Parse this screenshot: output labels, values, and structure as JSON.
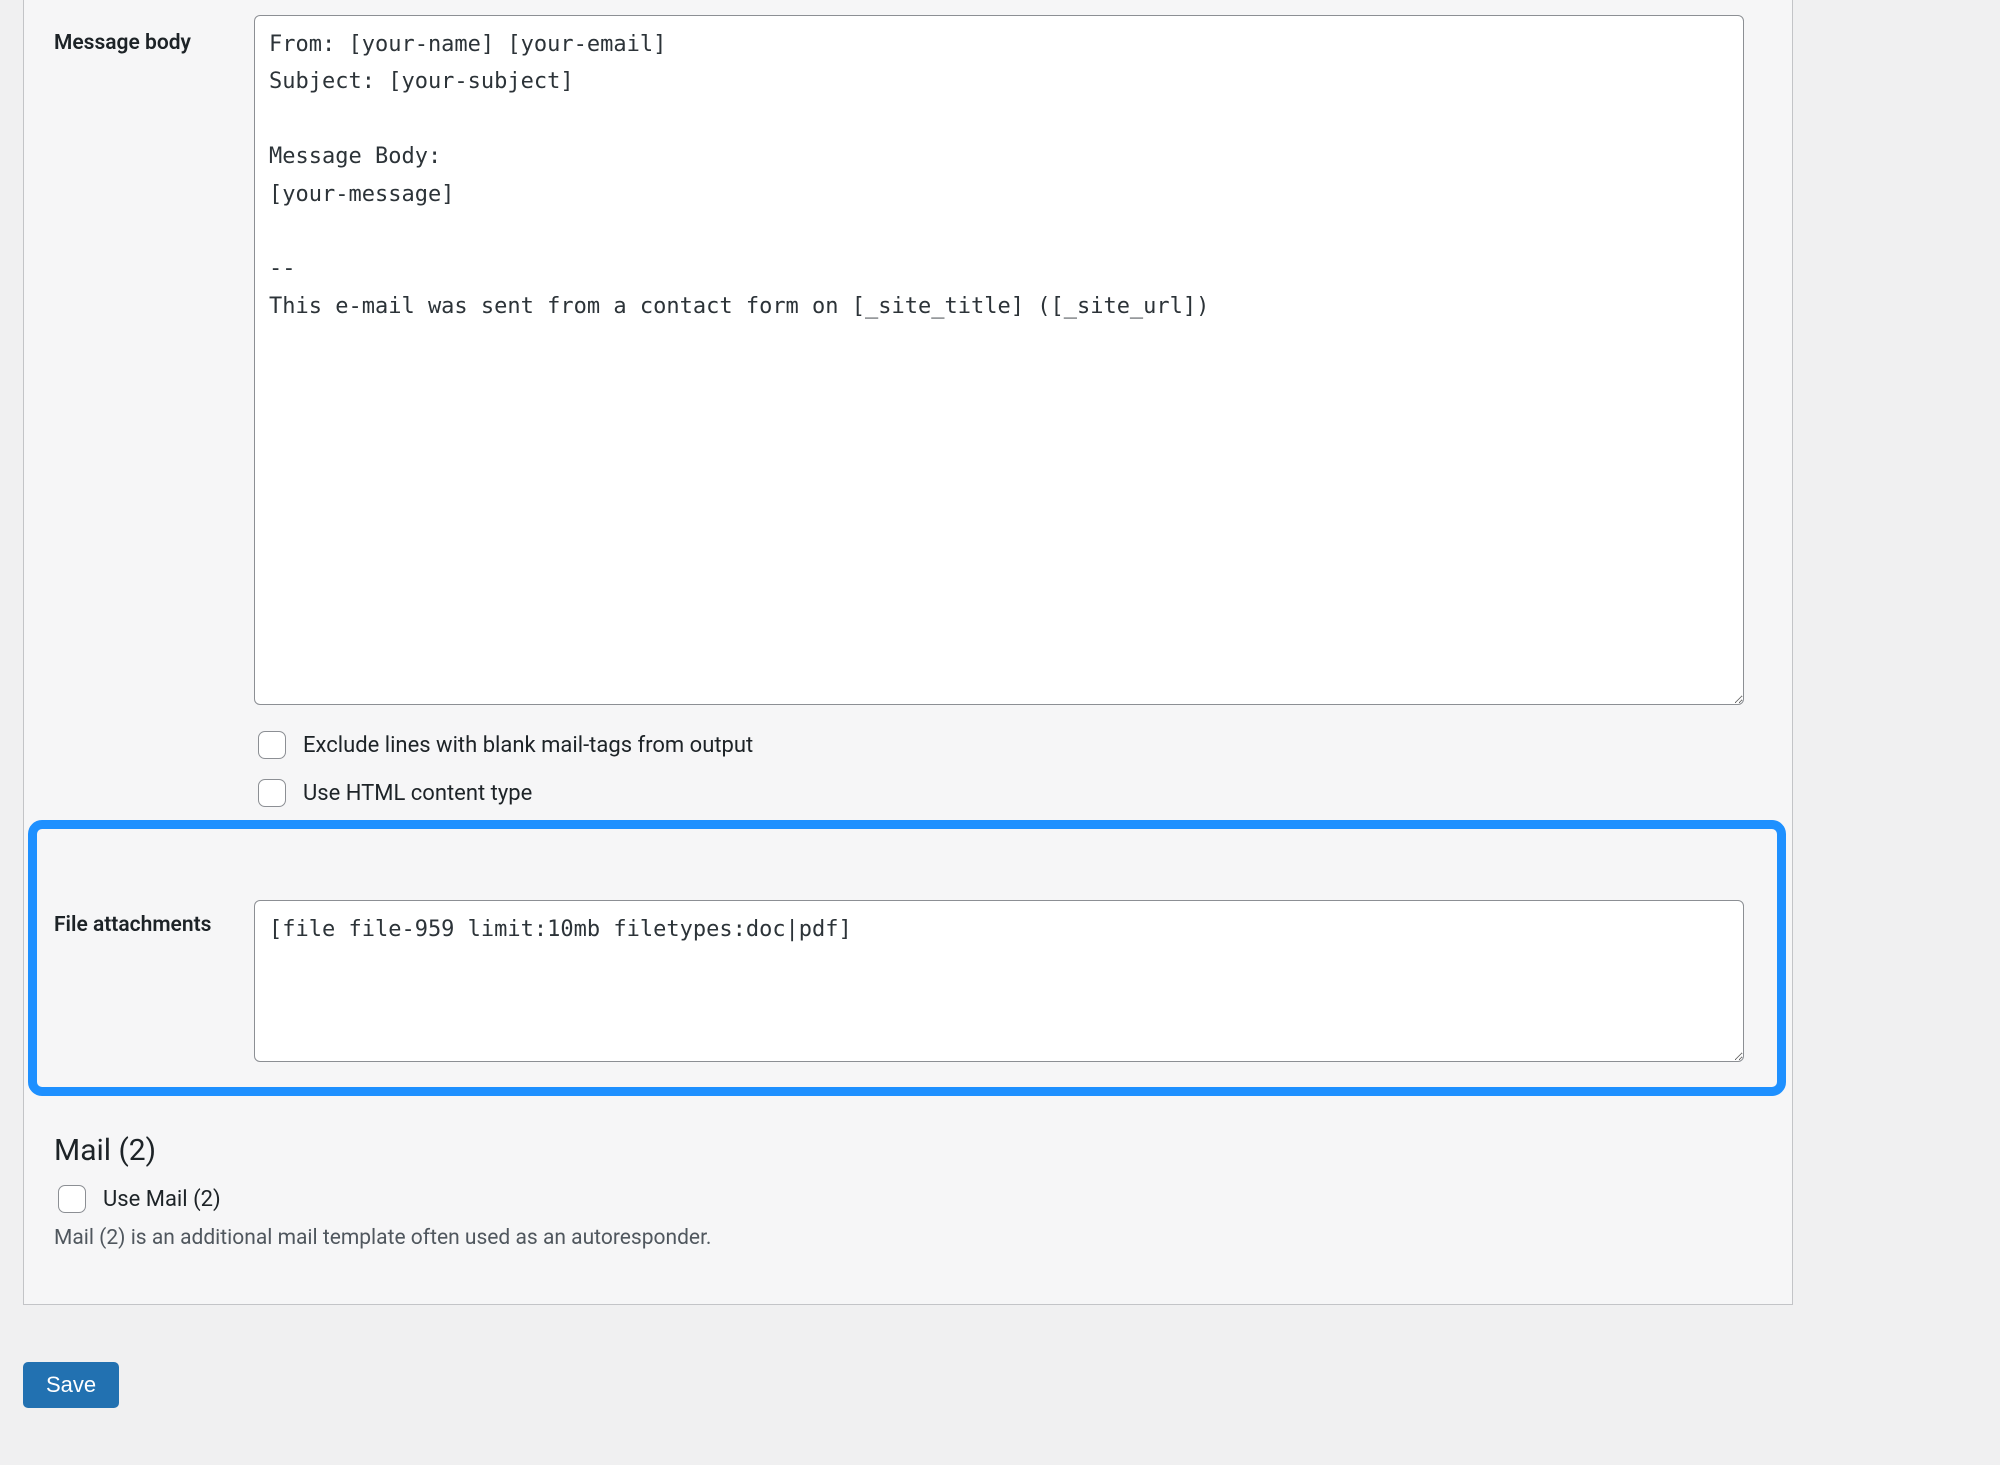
{
  "message_body": {
    "label": "Message body",
    "value": "From: [your-name] [your-email]\nSubject: [your-subject]\n\nMessage Body:\n[your-message]\n\n--\nThis e-mail was sent from a contact form on [_site_title] ([_site_url])",
    "checkbox_exclude_label": "Exclude lines with blank mail-tags from output",
    "checkbox_html_label": "Use HTML content type"
  },
  "file_attachments": {
    "label": "File attachments",
    "value": "[file file-959 limit:10mb filetypes:doc|pdf]"
  },
  "mail2": {
    "heading": "Mail (2)",
    "checkbox_label": "Use Mail (2)",
    "description": "Mail (2) is an additional mail template often used as an autoresponder."
  },
  "save_label": "Save"
}
